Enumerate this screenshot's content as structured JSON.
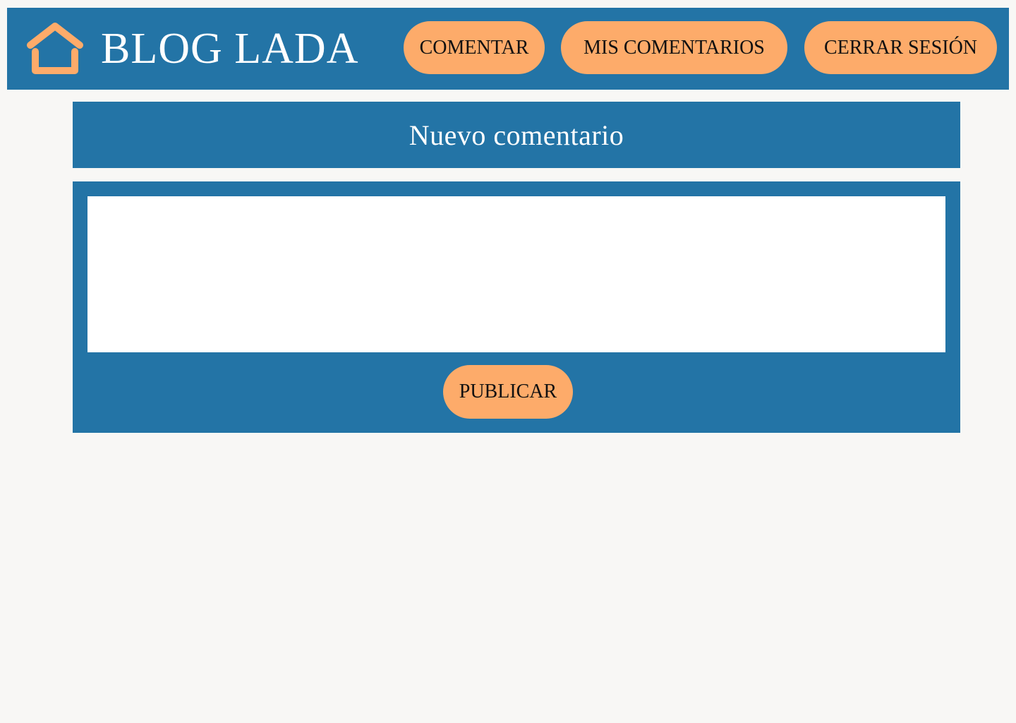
{
  "header": {
    "brand": "BLOG LADA",
    "home_icon": "home-icon",
    "nav": {
      "comentar": "COMENTAR",
      "mis_comentarios": "MIS COMENTARIOS",
      "cerrar_sesion": "CERRAR SESIÓN"
    }
  },
  "main": {
    "title": "Nuevo comentario",
    "comment_value": "",
    "publish_label": "PUBLICAR"
  },
  "colors": {
    "primary": "#2374a6",
    "accent": "#fdab6a",
    "background": "#f8f7f5",
    "text_light": "#ffffff",
    "text_dark": "#111111"
  }
}
